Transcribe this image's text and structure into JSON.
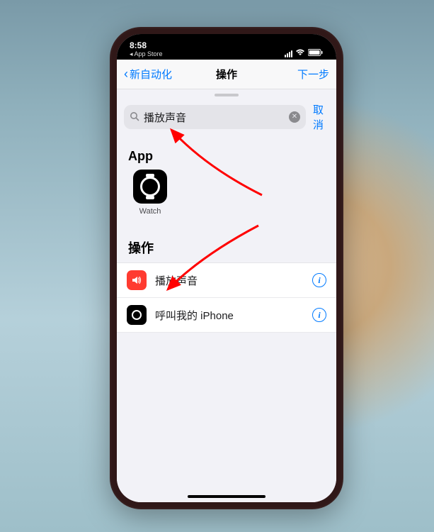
{
  "statusbar": {
    "time": "8:58",
    "back_app_label": "◂ App Store"
  },
  "navbar": {
    "back_label": "新自动化",
    "title": "操作",
    "next_label": "下一步"
  },
  "search": {
    "query": "播放声音",
    "cancel_label": "取消"
  },
  "sections": {
    "app_header": "App",
    "actions_header": "操作"
  },
  "apps": [
    {
      "id": "watch",
      "label": "Watch"
    }
  ],
  "actions": [
    {
      "id": "play-sound",
      "icon": "speaker",
      "label": "播放声音"
    },
    {
      "id": "ping-iphone",
      "icon": "watch",
      "label": "呼叫我的 iPhone"
    }
  ],
  "colors": {
    "ios_blue": "#007aff",
    "ios_red": "#ff3b30",
    "bg": "#f2f2f7"
  }
}
